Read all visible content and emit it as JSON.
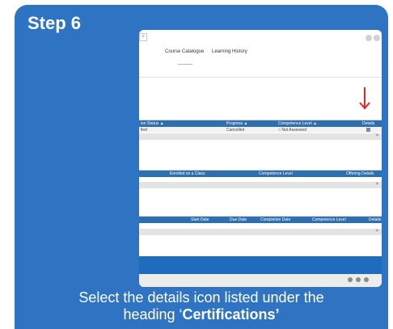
{
  "step_title": "Step 6",
  "nav": {
    "items": [
      "Course Catalogue",
      "Learning History"
    ]
  },
  "certifications_table": {
    "headers": [
      "ion Status ▲",
      "Progress ▲",
      "Competence Level ▲",
      "Details"
    ],
    "row": [
      "lled",
      "Cancelled",
      "○ Not Assessed"
    ],
    "scroll_arrow": ">"
  },
  "classes_table": {
    "headers": [
      "Enrolled on a Class",
      "Competence Level",
      "Offering Details"
    ],
    "scroll_arrow": ">"
  },
  "courses_table": {
    "headers": [
      "Start Date",
      "Due Date",
      "Completion Date",
      "Competence Level",
      "Details"
    ],
    "scroll_arrow": ">"
  },
  "colors": {
    "card_bg": "#2e74c2",
    "table_header": "#2e6fb0",
    "arrow": "#e8281e",
    "taskbar": "#1f6bbd"
  },
  "caption": {
    "line1": "Select the details icon listed under the",
    "line2_prefix": "heading ‘",
    "line2_bold": "Certifications’"
  }
}
